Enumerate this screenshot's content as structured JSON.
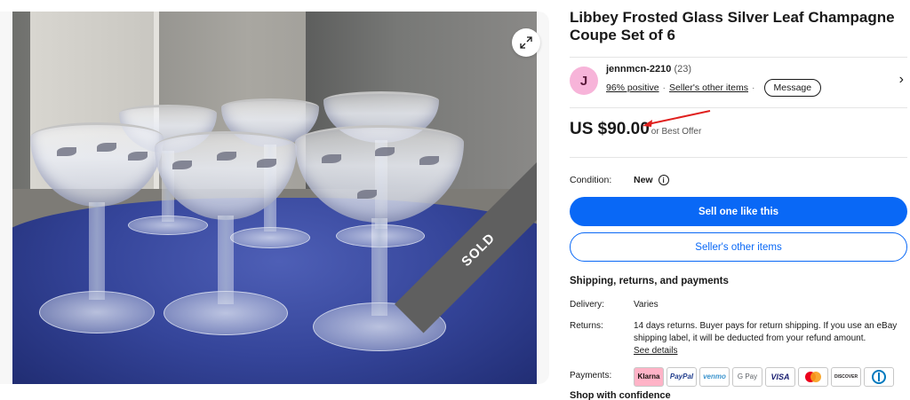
{
  "listing": {
    "title": "Libbey Frosted Glass Silver Leaf Champagne Coupe Set of 6",
    "sold_badge": "SOLD"
  },
  "seller": {
    "avatar_initial": "J",
    "name": "jennmcn-2210",
    "feedback_count": "(23)",
    "positive": "96% positive",
    "separator": "·",
    "other_items_link": "Seller's other items",
    "message_button": "Message",
    "chevron": "›"
  },
  "price": {
    "amount": "US $90.00",
    "offer_text": "or Best Offer"
  },
  "condition": {
    "label": "Condition:",
    "value": "New",
    "info_icon": "i"
  },
  "actions": {
    "sell_one": "Sell one like this",
    "other_items": "Seller's other items"
  },
  "shipping": {
    "heading": "Shipping, returns, and payments",
    "delivery_label": "Delivery:",
    "delivery_value": "Varies",
    "returns_label": "Returns:",
    "returns_value": "14 days returns. Buyer pays for return shipping. If you use an eBay shipping label, it will be deducted from your refund amount.",
    "see_details": "See details",
    "payments_label": "Payments:",
    "payment_methods": [
      "Klarna",
      "PayPal",
      "venmo",
      "G Pay",
      "VISA",
      "",
      "DISCOVER",
      ""
    ]
  },
  "shop_confidence": "Shop with confidence",
  "colors": {
    "primary_blue": "#0968f6",
    "sold_band": "#5f5f5f",
    "avatar_bg": "#f7b4d9",
    "arrow_red": "#e0201e"
  },
  "icons": [
    "expand-icon",
    "info-icon",
    "chevron-right-icon",
    "red-arrow-annotation"
  ]
}
